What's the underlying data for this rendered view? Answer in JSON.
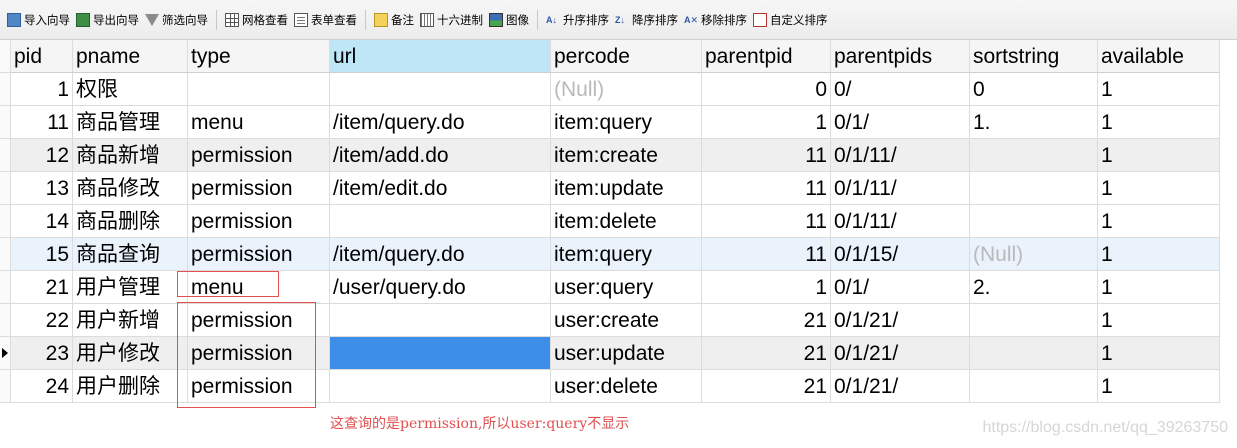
{
  "toolbar": {
    "import_wizard": "导入向导",
    "export_wizard": "导出向导",
    "filter_wizard": "筛选向导",
    "grid_view": "网格查看",
    "form_view": "表单查看",
    "memo": "备注",
    "hex": "十六进制",
    "image": "图像",
    "sort_asc": "升序排序",
    "sort_desc": "降序排序",
    "remove_sort": "移除排序",
    "custom_sort": "自定义排序"
  },
  "grid": {
    "columns": [
      "pid",
      "pname",
      "type",
      "url",
      "percode",
      "parentpid",
      "parentpids",
      "sortstring",
      "available"
    ],
    "rows": [
      [
        "1",
        "权限",
        "",
        "",
        "(Null)",
        "0",
        "0/",
        "0",
        "1"
      ],
      [
        "11",
        "商品管理",
        "menu",
        "/item/query.do",
        "item:query",
        "1",
        "0/1/",
        "1.",
        "1"
      ],
      [
        "12",
        "商品新增",
        "permission",
        "/item/add.do",
        "item:create",
        "11",
        "0/1/11/",
        "",
        "1"
      ],
      [
        "13",
        "商品修改",
        "permission",
        "/item/edit.do",
        "item:update",
        "11",
        "0/1/11/",
        "",
        "1"
      ],
      [
        "14",
        "商品删除",
        "permission",
        "",
        "item:delete",
        "11",
        "0/1/11/",
        "",
        "1"
      ],
      [
        "15",
        "商品查询",
        "permission",
        "/item/query.do",
        "item:query",
        "11",
        "0/1/15/",
        "(Null)",
        "1"
      ],
      [
        "21",
        "用户管理",
        "menu",
        "/user/query.do",
        "user:query",
        "1",
        "0/1/",
        "2.",
        "1"
      ],
      [
        "22",
        "用户新增",
        "permission",
        "",
        "user:create",
        "21",
        "0/1/21/",
        "",
        "1"
      ],
      [
        "23",
        "用户修改",
        "permission",
        "",
        "user:update",
        "21",
        "0/1/21/",
        "",
        "1"
      ],
      [
        "24",
        "用户删除",
        "permission",
        "",
        "user:delete",
        "21",
        "0/1/21/",
        "",
        "1"
      ]
    ]
  },
  "annotation": "这查询的是permission,所以user:query不显示",
  "watermark": "https://blog.csdn.net/qq_39263750",
  "colors": {
    "annotation_red": "#e05050",
    "selected_header": "#bfe6f7",
    "selected_cell": "#3c8ee8",
    "null_text": "#b9b9b9"
  }
}
